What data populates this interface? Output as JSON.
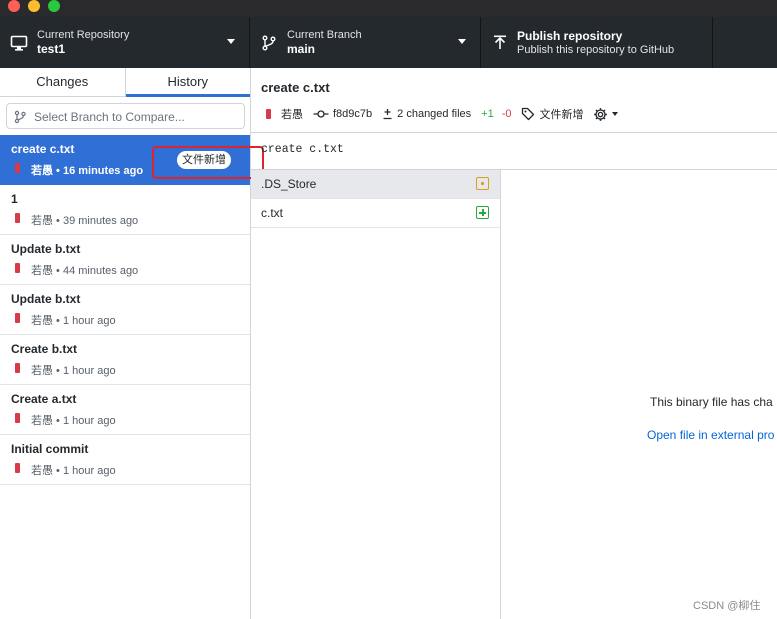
{
  "toolbar": {
    "repository": {
      "label": "Current Repository",
      "value": "test1"
    },
    "branch": {
      "label": "Current Branch",
      "value": "main"
    },
    "publish": {
      "title": "Publish repository",
      "subtitle": "Publish this repository to GitHub"
    }
  },
  "sidebar": {
    "tabs": [
      {
        "label": "Changes"
      },
      {
        "label": "History"
      }
    ],
    "active_tab": "History",
    "compare_placeholder": "Select Branch to Compare...",
    "commits": [
      {
        "summary": "create c.txt",
        "author": "若愚",
        "time": "16 minutes ago",
        "meta": "若愚 • 16 minutes ago",
        "tag": "文件新增",
        "selected": true
      },
      {
        "summary": "1",
        "author": "若愚",
        "time": "39 minutes ago",
        "meta": "若愚 • 39 minutes ago"
      },
      {
        "summary": "Update b.txt",
        "author": "若愚",
        "time": "44 minutes ago",
        "meta": "若愚 • 44 minutes ago"
      },
      {
        "summary": "Update b.txt",
        "author": "若愚",
        "time": "1 hour ago",
        "meta": "若愚 • 1 hour ago"
      },
      {
        "summary": "Create b.txt",
        "author": "若愚",
        "time": "1 hour ago",
        "meta": "若愚 • 1 hour ago"
      },
      {
        "summary": "Create a.txt",
        "author": "若愚",
        "time": "1 hour ago",
        "meta": "若愚 • 1 hour ago"
      },
      {
        "summary": "Initial commit",
        "author": "若愚",
        "time": "1 hour ago",
        "meta": "若愚 • 1 hour ago"
      }
    ]
  },
  "detail": {
    "title": "create c.txt",
    "author": "若愚",
    "sha": "f8d9c7b",
    "changed_files": "2 changed files",
    "additions": "+1",
    "deletions": "-0",
    "tag": "文件新增",
    "description": "create c.txt",
    "files": [
      {
        "name": ".DS_Store",
        "status": "modified",
        "selected": true
      },
      {
        "name": "c.txt",
        "status": "new"
      }
    ],
    "diff": {
      "binary_message": "This binary file has cha",
      "open_external": "Open file in external pro"
    }
  },
  "watermark": "CSDN @柳住",
  "colors": {
    "accent": "#2f6fd6",
    "toolbar_bg": "#24292e",
    "highlight": "#e0242c",
    "added": "#28a745",
    "deleted": "#d73a49",
    "modified": "#d9a21b"
  }
}
